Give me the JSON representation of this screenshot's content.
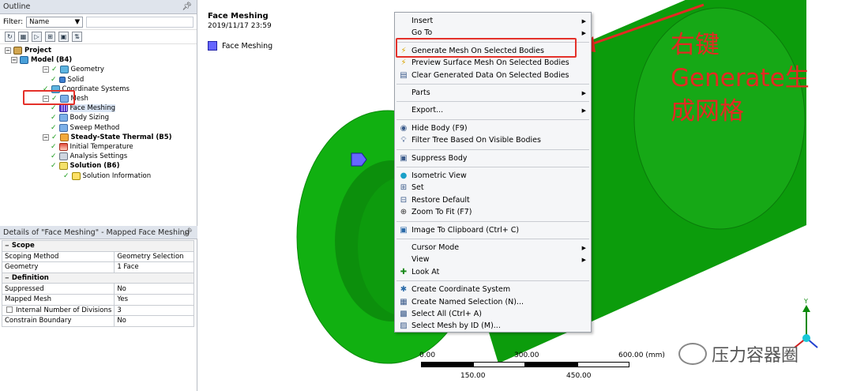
{
  "outline": {
    "title": "Outline",
    "filter_label": "Filter:",
    "filter_value": "Name",
    "tree": [
      {
        "label": "Project",
        "depth": 0,
        "icon": "project-icon",
        "bold": true
      },
      {
        "label": "Model (B4)",
        "depth": 1,
        "icon": "model-icon",
        "bold": true
      },
      {
        "label": "Geometry",
        "depth": 2,
        "icon": "geometry-icon"
      },
      {
        "label": "Solid",
        "depth": 3,
        "icon": "solid-icon"
      },
      {
        "label": "Coordinate Systems",
        "depth": 2,
        "icon": "coordinate-icon"
      },
      {
        "label": "Mesh",
        "depth": 2,
        "icon": "mesh-icon"
      },
      {
        "label": "Face Meshing",
        "depth": 3,
        "icon": "face-meshing-icon",
        "selected": true
      },
      {
        "label": "Body Sizing",
        "depth": 3,
        "icon": "body-sizing-icon"
      },
      {
        "label": "Sweep Method",
        "depth": 3,
        "icon": "sweep-icon"
      },
      {
        "label": "Steady-State Thermal (B5)",
        "depth": 2,
        "icon": "thermal-icon",
        "bold": true
      },
      {
        "label": "Initial Temperature",
        "depth": 3,
        "icon": "temperature-icon"
      },
      {
        "label": "Analysis Settings",
        "depth": 3,
        "icon": "settings-icon"
      },
      {
        "label": "Solution (B6)",
        "depth": 3,
        "icon": "solution-icon",
        "bold": true
      },
      {
        "label": "Solution Information",
        "depth": 4,
        "icon": "info-icon"
      }
    ]
  },
  "details": {
    "title": "Details of \"Face Meshing\" - Mapped Face Meshing",
    "rows": [
      {
        "group": "Scope"
      },
      {
        "label": "Scoping Method",
        "value": "Geometry Selection"
      },
      {
        "label": "Geometry",
        "value": "1 Face"
      },
      {
        "group": "Definition"
      },
      {
        "label": "Suppressed",
        "value": "No"
      },
      {
        "label": "Mapped Mesh",
        "value": "Yes"
      },
      {
        "label": "Internal Number of Divisions",
        "value": "3",
        "checkbox": true
      },
      {
        "label": "Constrain Boundary",
        "value": "No"
      }
    ]
  },
  "viewport": {
    "title": "Face Meshing",
    "date": "2019/11/17 23:59",
    "legend_label": "Face Meshing",
    "legend_color": "#6666ff",
    "body_color": "#0c9c0c",
    "scale_top": [
      "0.00",
      "300.00",
      "600.00 (mm)"
    ],
    "scale_bottom": [
      "150.00",
      "450.00"
    ],
    "axis_label": "Y"
  },
  "context_menu": [
    {
      "label": "Insert",
      "submenu": true
    },
    {
      "label": "Go To",
      "submenu": true
    },
    {
      "sep": true
    },
    {
      "label": "Generate Mesh On Selected Bodies",
      "icon": "lightning-icon"
    },
    {
      "label": "Preview Surface Mesh On Selected Bodies",
      "icon": "lightning-icon"
    },
    {
      "label": "Clear Generated Data On Selected Bodies",
      "icon": "clear-icon"
    },
    {
      "sep": true
    },
    {
      "label": "Parts",
      "submenu": true
    },
    {
      "sep": true
    },
    {
      "label": "Export...",
      "submenu": true
    },
    {
      "sep": true
    },
    {
      "label": "Hide Body (F9)",
      "icon": "eye-icon"
    },
    {
      "label": "Filter Tree Based On Visible Bodies",
      "icon": "bulb-icon"
    },
    {
      "sep": true
    },
    {
      "label": "Suppress Body",
      "icon": "suppress-icon"
    },
    {
      "sep": true
    },
    {
      "label": "Isometric View",
      "icon": "sphere-icon"
    },
    {
      "label": "Set",
      "icon": "iso-set-icon"
    },
    {
      "label": "Restore Default",
      "icon": "iso-restore-icon"
    },
    {
      "label": "Zoom To Fit (F7)",
      "icon": "zoom-icon"
    },
    {
      "sep": true
    },
    {
      "label": "Image To Clipboard (Ctrl+ C)",
      "icon": "camera-icon"
    },
    {
      "sep": true
    },
    {
      "label": "Cursor Mode",
      "submenu": true
    },
    {
      "label": "View",
      "submenu": true
    },
    {
      "label": "Look At",
      "icon": "look-at-icon"
    },
    {
      "sep": true
    },
    {
      "label": "Create Coordinate System",
      "icon": "coord-sys-icon"
    },
    {
      "label": "Create Named Selection (N)...",
      "icon": "named-selection-icon"
    },
    {
      "label": "Select All (Ctrl+ A)",
      "icon": "select-all-icon"
    },
    {
      "label": "Select Mesh by ID (M)...",
      "icon": "select-mesh-icon"
    }
  ],
  "annotation": {
    "lines": [
      "右键",
      "Generate生",
      "成网格"
    ],
    "color": "#e32a22"
  },
  "watermark": "压力容器圈"
}
